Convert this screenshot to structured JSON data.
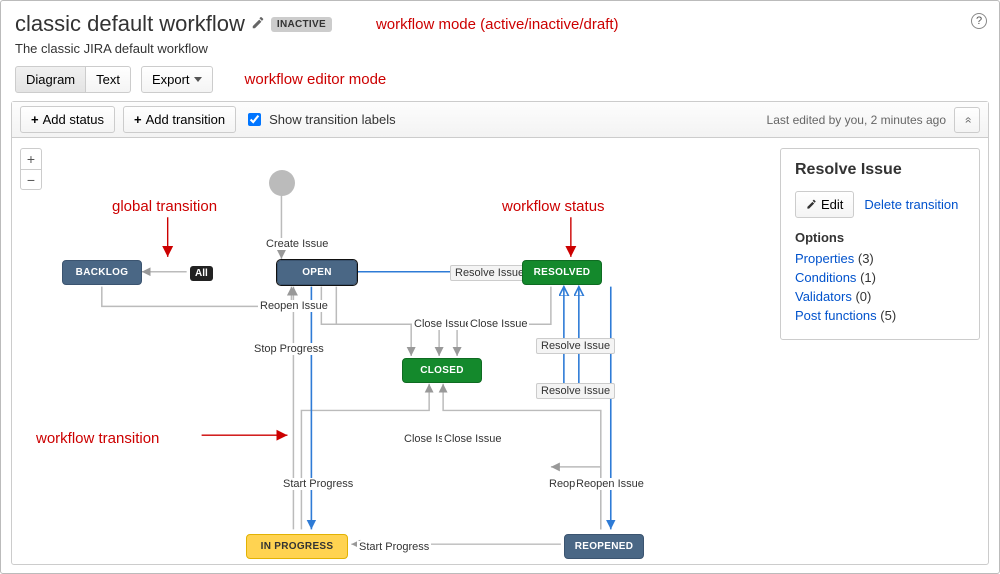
{
  "header": {
    "title": "classic default workflow",
    "status_lozenge": "INACTIVE",
    "subtitle": "The classic JIRA default workflow"
  },
  "toolbar": {
    "diagram": "Diagram",
    "text": "Text",
    "export": "Export"
  },
  "actions": {
    "add_status": "Add status",
    "add_transition": "Add transition",
    "show_labels": "Show transition labels",
    "last_edited": "Last edited by you, 2 minutes ago"
  },
  "annotations": {
    "mode": "workflow mode (active/inactive/draft)",
    "editor_mode": "workflow editor mode",
    "global_transition": "global transition",
    "workflow_status": "workflow status",
    "workflow_transition": "workflow transition"
  },
  "nodes": {
    "backlog": "BACKLOG",
    "open": "OPEN",
    "resolved": "RESOLVED",
    "closed": "CLOSED",
    "in_progress": "IN PROGRESS",
    "reopened": "REOPENED"
  },
  "all_lozenge": "All",
  "transitions": {
    "create_issue": "Create Issue",
    "reopen_issue": "Reopen Issue",
    "stop_progress": "Stop Progress",
    "start_progress": "Start Progress",
    "close_issue": "Close Issue",
    "resolve_issue": "Resolve Issue",
    "reopen_short": "Reop"
  },
  "side": {
    "title": "Resolve Issue",
    "edit": "Edit",
    "delete": "Delete transition",
    "options_h": "Options",
    "properties": "Properties",
    "properties_n": "(3)",
    "conditions": "Conditions",
    "conditions_n": "(1)",
    "validators": "Validators",
    "validators_n": "(0)",
    "postfn": "Post functions",
    "postfn_n": "(5)"
  }
}
